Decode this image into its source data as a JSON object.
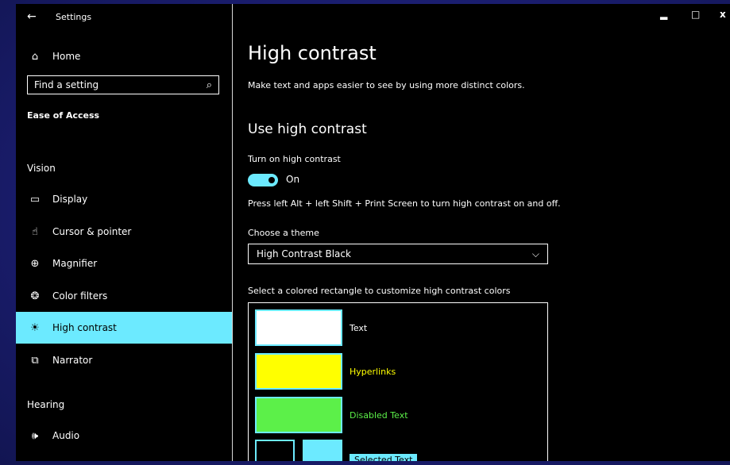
{
  "window": {
    "title": "Settings",
    "back_icon": "←",
    "controls": {
      "minimize": "▂",
      "maximize": "□",
      "close": "x"
    }
  },
  "sidebar": {
    "home_label": "Home",
    "home_icon": "⌂",
    "search": {
      "placeholder": "Find a setting",
      "icon": "⌕"
    },
    "section_title": "Ease of Access",
    "groups": {
      "vision": "Vision",
      "hearing": "Hearing"
    },
    "items": [
      {
        "label": "Display",
        "icon": "▭"
      },
      {
        "label": "Cursor & pointer",
        "icon": "☝"
      },
      {
        "label": "Magnifier",
        "icon": "⊕"
      },
      {
        "label": "Color filters",
        "icon": "❂"
      },
      {
        "label": "High contrast",
        "icon": "☀"
      },
      {
        "label": "Narrator",
        "icon": "⧉"
      },
      {
        "label": "Audio",
        "icon": "🕪"
      }
    ]
  },
  "main": {
    "title": "High contrast",
    "description": "Make text and apps easier to see by using more distinct colors.",
    "section_title": "Use high contrast",
    "toggle": {
      "label": "Turn on high contrast",
      "state": "On"
    },
    "shortcut_text": "Press left Alt + left Shift + Print Screen to turn high contrast on and off.",
    "theme": {
      "label": "Choose a theme",
      "selected": "High Contrast Black",
      "chevron": "⌵"
    },
    "colors": {
      "label": "Select a colored rectangle to customize high contrast colors",
      "text": "Text",
      "hyperlinks": "Hyperlinks",
      "disabled_text": "Disabled Text",
      "selected_text": "Selected Text"
    }
  },
  "palette": {
    "accent": "#6ceaff",
    "text_color": "#ffffff",
    "hyperlink_color": "#ffff00",
    "disabled_color": "#5cf049",
    "background": "#000000"
  }
}
